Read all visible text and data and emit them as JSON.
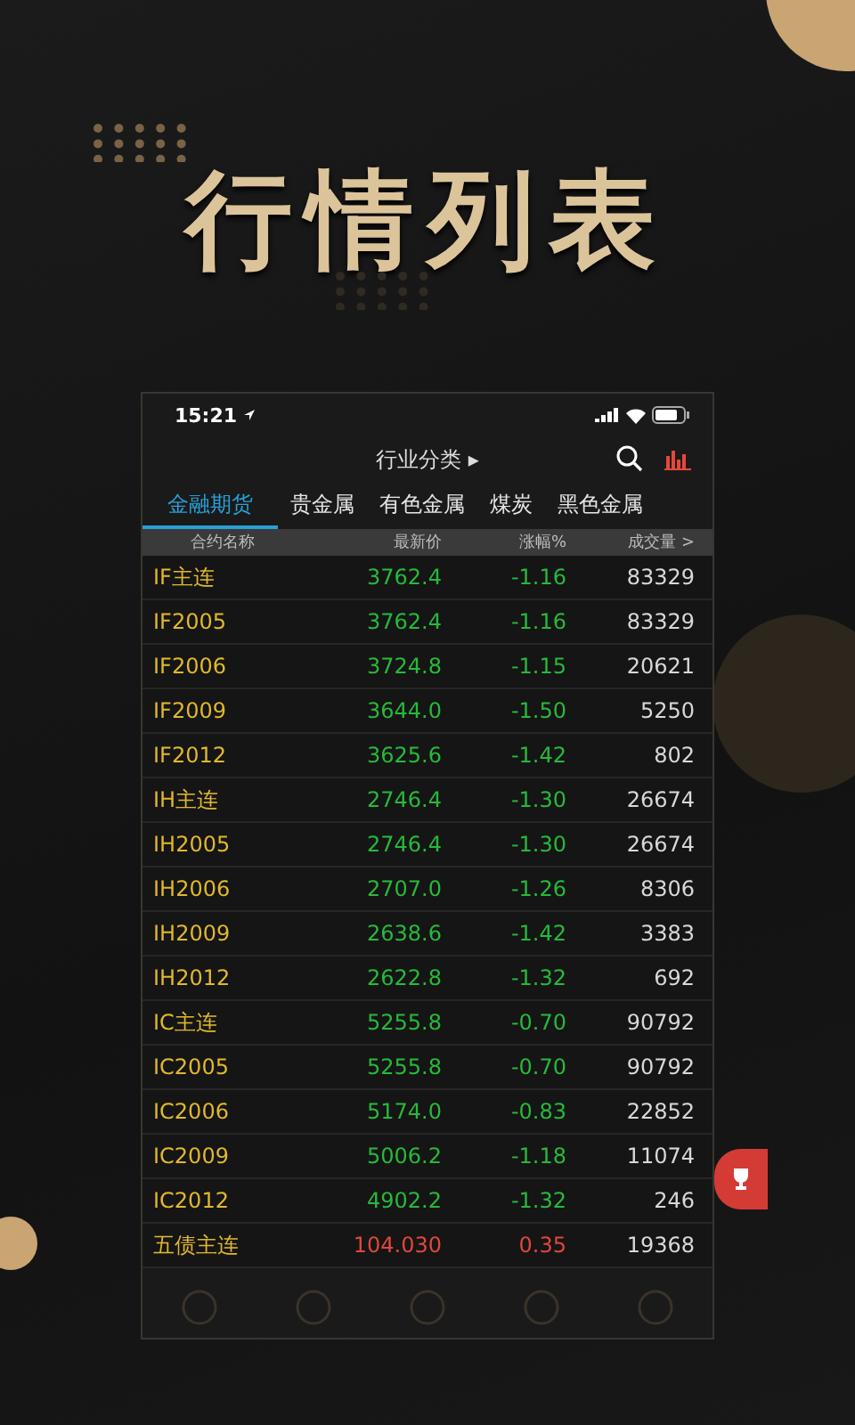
{
  "headline": "行情列表",
  "status_bar": {
    "time": "15:21"
  },
  "nav": {
    "title": "行业分类",
    "caret": "▸"
  },
  "tabs": [
    {
      "label": "金融期货",
      "selected": true
    },
    {
      "label": "贵金属",
      "selected": false
    },
    {
      "label": "有色金属",
      "selected": false
    },
    {
      "label": "煤炭",
      "selected": false
    },
    {
      "label": "黑色金属",
      "selected": false
    }
  ],
  "columns": [
    "合约名称",
    "最新价",
    "涨幅%",
    "成交量 >"
  ],
  "rows": [
    {
      "name": "IF主连",
      "price": "3762.4",
      "change": "-1.16",
      "volume": "83329",
      "color": "#27b93a"
    },
    {
      "name": "IF2005",
      "price": "3762.4",
      "change": "-1.16",
      "volume": "83329",
      "color": "#27b93a"
    },
    {
      "name": "IF2006",
      "price": "3724.8",
      "change": "-1.15",
      "volume": "20621",
      "color": "#27b93a"
    },
    {
      "name": "IF2009",
      "price": "3644.0",
      "change": "-1.50",
      "volume": "5250",
      "color": "#27b93a"
    },
    {
      "name": "IF2012",
      "price": "3625.6",
      "change": "-1.42",
      "volume": "802",
      "color": "#27b93a"
    },
    {
      "name": "IH主连",
      "price": "2746.4",
      "change": "-1.30",
      "volume": "26674",
      "color": "#27b93a"
    },
    {
      "name": "IH2005",
      "price": "2746.4",
      "change": "-1.30",
      "volume": "26674",
      "color": "#27b93a"
    },
    {
      "name": "IH2006",
      "price": "2707.0",
      "change": "-1.26",
      "volume": "8306",
      "color": "#27b93a"
    },
    {
      "name": "IH2009",
      "price": "2638.6",
      "change": "-1.42",
      "volume": "3383",
      "color": "#27b93a"
    },
    {
      "name": "IH2012",
      "price": "2622.8",
      "change": "-1.32",
      "volume": "692",
      "color": "#27b93a"
    },
    {
      "name": "IC主连",
      "price": "5255.8",
      "change": "-0.70",
      "volume": "90792",
      "color": "#27b93a"
    },
    {
      "name": "IC2005",
      "price": "5255.8",
      "change": "-0.70",
      "volume": "90792",
      "color": "#27b93a"
    },
    {
      "name": "IC2006",
      "price": "5174.0",
      "change": "-0.83",
      "volume": "22852",
      "color": "#27b93a"
    },
    {
      "name": "IC2009",
      "price": "5006.2",
      "change": "-1.18",
      "volume": "11074",
      "color": "#27b93a"
    },
    {
      "name": "IC2012",
      "price": "4902.2",
      "change": "-1.32",
      "volume": "246",
      "color": "#27b93a"
    },
    {
      "name": "五债主连",
      "price": "104.030",
      "change": "0.35",
      "volume": "19368",
      "color": "#e0473a"
    }
  ]
}
